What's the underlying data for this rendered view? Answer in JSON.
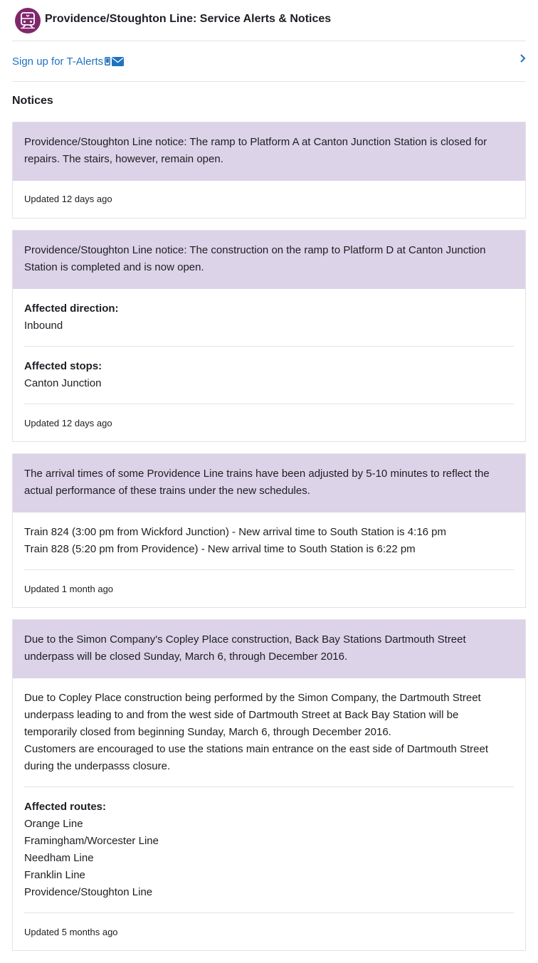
{
  "header": {
    "title": "Providence/Stoughton Line: Service Alerts & Notices",
    "icon": "commuter-rail-icon",
    "icon_color": "#80276c"
  },
  "talerts": {
    "label": "Sign up for T-Alerts",
    "link_color": "#1f72c0"
  },
  "notices": {
    "heading": "Notices",
    "header_bg": "#dcd3e8",
    "items": [
      {
        "title": "Providence/Stoughton Line notice: The ramp to Platform A at Canton Junction Station is closed for repairs. The stairs, however, remain open.",
        "updated": "Updated 12 days ago"
      },
      {
        "title": "Providence/Stoughton Line notice: The construction on the ramp to Platform D at Canton Junction Station is completed and is now open.",
        "direction_label": "Affected direction:",
        "direction_value": "Inbound",
        "stops_label": "Affected stops:",
        "stops_value": "Canton Junction",
        "updated": "Updated 12 days ago"
      },
      {
        "title": "The arrival times of some Providence Line trains have been adjusted by 5-10 minutes to reflect the actual performance of these trains under the new schedules.",
        "details": [
          "Train 824 (3:00 pm from Wickford Junction) - New arrival time to South Station is 4:16 pm",
          "Train 828 (5:20 pm from Providence) - New arrival time to South Station is 6:22 pm"
        ],
        "updated": "Updated 1 month ago"
      },
      {
        "title": "Due to the Simon Company's Copley Place construction, Back Bay Stations Dartmouth Street underpass will be closed Sunday, March 6, through December 2016.",
        "description_1": "Due to Copley Place construction being performed by the Simon Company, the Dartmouth Street underpass leading to and from the west side of Dartmouth Street at Back Bay Station will be temporarily closed from beginning Sunday, March 6, through December 2016.",
        "description_2": "Customers are encouraged to use the stations main entrance on the east side of Dartmouth Street during the underpasss closure.",
        "routes_label": "Affected routes:",
        "routes": [
          "Orange Line",
          "Framingham/Worcester Line",
          "Needham Line",
          "Franklin Line",
          "Providence/Stoughton Line"
        ],
        "updated": "Updated 5 months ago"
      }
    ]
  }
}
